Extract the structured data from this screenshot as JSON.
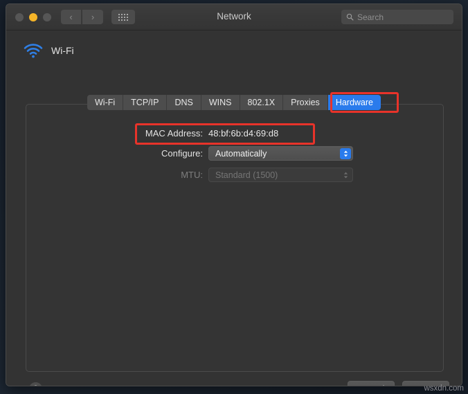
{
  "window": {
    "title": "Network",
    "traffic_lights": [
      "close",
      "minimize",
      "zoom"
    ],
    "nav": {
      "back": "‹",
      "forward": "›"
    },
    "grid_button": "show-all-icon"
  },
  "search": {
    "placeholder": "Search",
    "value": "",
    "icon": "search-icon"
  },
  "service": {
    "name": "Wi-Fi",
    "icon": "wifi-icon"
  },
  "tabs": [
    {
      "label": "Wi-Fi",
      "selected": false
    },
    {
      "label": "TCP/IP",
      "selected": false
    },
    {
      "label": "DNS",
      "selected": false
    },
    {
      "label": "WINS",
      "selected": false
    },
    {
      "label": "802.1X",
      "selected": false
    },
    {
      "label": "Proxies",
      "selected": false
    },
    {
      "label": "Hardware",
      "selected": true
    }
  ],
  "form": {
    "mac": {
      "label": "MAC Address:",
      "value": "48:bf:6b:d4:69:d8"
    },
    "configure": {
      "label": "Configure:",
      "value": "Automatically",
      "enabled": true
    },
    "mtu": {
      "label": "MTU:",
      "value": "Standard (1500)",
      "enabled": false
    }
  },
  "footer": {
    "help_label": "?",
    "cancel_label": "Cancel",
    "ok_label": "OK"
  },
  "annotations": [
    {
      "name": "hardware-tab-highlight",
      "color": "#e8332a"
    },
    {
      "name": "mac-address-highlight",
      "color": "#e8332a"
    }
  ],
  "watermark": "wsxdn.com",
  "colors": {
    "accent": "#2a7bec",
    "annotation": "#e8332a",
    "window_bg": "#333333",
    "titlebar_bg": "#3b3b3b"
  }
}
